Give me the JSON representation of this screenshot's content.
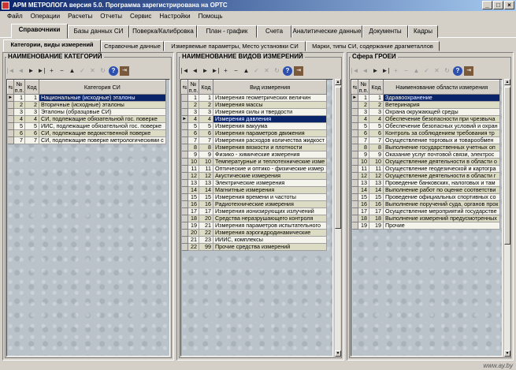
{
  "window": {
    "title": "АРМ МЕТРОЛОГА версия 5.0.  Программа зарегистрирована на  ОРТС",
    "buttons": [
      "_",
      "□",
      "×"
    ]
  },
  "menu": [
    "Файл",
    "Операции",
    "Расчеты",
    "Отчеты",
    "Сервис",
    "Настройки",
    "Помощь"
  ],
  "main_tabs": [
    "Справочники",
    "Базы данных СИ",
    "Поверка/Калибровка",
    "План - график",
    "Счета",
    "Аналитические данные",
    "Документы",
    "Кадры"
  ],
  "sub_tabs": [
    "Категории, виды измерений",
    "Справочные данные",
    "Измеряемые параметры, Место установки СИ",
    "Марки, типы СИ, содержание драгметаллов"
  ],
  "panel1": {
    "title": "НАИМЕНОВАНИЕ КАТЕГОРИЙ",
    "headers": [
      "№ п.п.",
      "Код",
      "Категория СИ"
    ],
    "rows": [
      {
        "n": "1",
        "code": "1",
        "name": "Национальные (исходные) эталоны"
      },
      {
        "n": "2",
        "code": "2",
        "name": "Вторичные (исходные) эталоны"
      },
      {
        "n": "3",
        "code": "3",
        "name": "Эталоны (образцовые СИ)"
      },
      {
        "n": "4",
        "code": "4",
        "name": "СИ, подлежащие обязательной гос. поверке"
      },
      {
        "n": "5",
        "code": "5",
        "name": "ИИС, подлежащие обязательной гос. поверке"
      },
      {
        "n": "6",
        "code": "6",
        "name": "СИ, подлежащие ведомственной поверке"
      },
      {
        "n": "7",
        "code": "7",
        "name": "СИ, подлежащие поверке метрологическими с"
      }
    ]
  },
  "panel2": {
    "title": "НАИМЕНОВАНИЕ ВИДОВ ИЗМЕРЕНИЙ",
    "headers": [
      "№ п.п.",
      "Код",
      "Вид измерения"
    ],
    "rows": [
      {
        "n": "1",
        "code": "1",
        "name": "Измерения геометрических величин"
      },
      {
        "n": "2",
        "code": "2",
        "name": "Измерения массы"
      },
      {
        "n": "3",
        "code": "3",
        "name": "Измерения силы и твердости"
      },
      {
        "n": "4",
        "code": "4",
        "name": "Измерения давления"
      },
      {
        "n": "5",
        "code": "5",
        "name": "Измерения вакуума"
      },
      {
        "n": "6",
        "code": "6",
        "name": "Измерения параметров движения"
      },
      {
        "n": "7",
        "code": "7",
        "name": "Измерения расходов количества жидкост"
      },
      {
        "n": "8",
        "code": "8",
        "name": "Измерения вязкости и плотности"
      },
      {
        "n": "9",
        "code": "9",
        "name": "Физико - химические измерения"
      },
      {
        "n": "10",
        "code": "10",
        "name": "Температурные и теплотехнические изме"
      },
      {
        "n": "11",
        "code": "11",
        "name": "Оптические и оптико - физические измер"
      },
      {
        "n": "12",
        "code": "12",
        "name": "Акустические измерения"
      },
      {
        "n": "13",
        "code": "13",
        "name": "Электрические измерения"
      },
      {
        "n": "14",
        "code": "14",
        "name": "Магнитные измерения"
      },
      {
        "n": "15",
        "code": "15",
        "name": "Измерения времени и частоты"
      },
      {
        "n": "16",
        "code": "16",
        "name": "Радиотехнические измерения"
      },
      {
        "n": "17",
        "code": "17",
        "name": "Измерения ионизирующих излучений"
      },
      {
        "n": "18",
        "code": "20",
        "name": "Средства неразрушающего контроля"
      },
      {
        "n": "19",
        "code": "21",
        "name": "Измерения параметров испытательного"
      },
      {
        "n": "20",
        "code": "22",
        "name": "Измерения аэрогидродинамические"
      },
      {
        "n": "21",
        "code": "23",
        "name": "ИИИС, комплексы"
      },
      {
        "n": "22",
        "code": "99",
        "name": "Прочие средства измерений"
      }
    ]
  },
  "panel3": {
    "title": "Сфера ГРОЕИ",
    "headers": [
      "№ п.п.",
      "Код",
      "Наименование области измерения"
    ],
    "rows": [
      {
        "n": "1",
        "code": "1",
        "name": "Здравоохранение"
      },
      {
        "n": "2",
        "code": "2",
        "name": "Ветеринария"
      },
      {
        "n": "3",
        "code": "3",
        "name": "Охрана окружающей среды"
      },
      {
        "n": "4",
        "code": "4",
        "name": "Обеспечение безопасности при чрезвыча"
      },
      {
        "n": "5",
        "code": "5",
        "name": "Обеспечение безопасных условий и охран"
      },
      {
        "n": "6",
        "code": "6",
        "name": "Контроль за соблюдением требования тр"
      },
      {
        "n": "7",
        "code": "7",
        "name": "Осуществление торговых и товарообмен"
      },
      {
        "n": "8",
        "code": "8",
        "name": "Выполнение государственных учетных оп"
      },
      {
        "n": "9",
        "code": "9",
        "name": "Оказание услуг почтовой связи, электрос"
      },
      {
        "n": "10",
        "code": "10",
        "name": "Осуществление деятельности в области о"
      },
      {
        "n": "11",
        "code": "11",
        "name": "Осуществление геодезической и картогра"
      },
      {
        "n": "12",
        "code": "12",
        "name": "Осуществление деятельности в области г"
      },
      {
        "n": "13",
        "code": "13",
        "name": "Проведение банковских, налоговых и там"
      },
      {
        "n": "14",
        "code": "14",
        "name": "Выполнение работ по оценке соответстви"
      },
      {
        "n": "15",
        "code": "15",
        "name": "Проведение официальных спортивных со"
      },
      {
        "n": "16",
        "code": "16",
        "name": "Выполнение поручений суда, органов прок"
      },
      {
        "n": "17",
        "code": "17",
        "name": "Осуществление мероприятий государстве"
      },
      {
        "n": "18",
        "code": "18",
        "name": "Выполнение измерений предусмотренных"
      },
      {
        "n": "19",
        "code": "19",
        "name": "Прочие"
      }
    ]
  },
  "toolbar_icons": [
    "first-icon",
    "prev-icon",
    "next-icon",
    "last-icon",
    "add-icon",
    "delete-icon",
    "up-icon",
    "save-icon",
    "cancel-icon",
    "refresh-icon",
    "help-icon",
    "exit-icon"
  ],
  "watermark": "www.ay.by"
}
